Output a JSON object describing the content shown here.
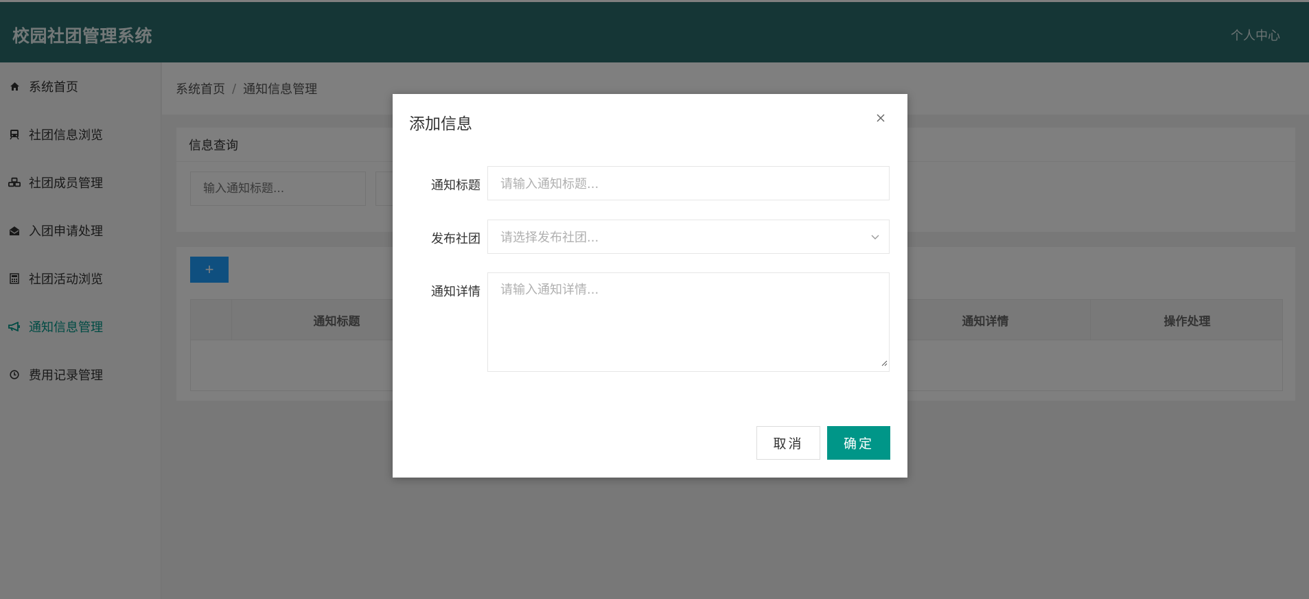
{
  "header": {
    "app_title": "校园社团管理系统",
    "user_center": "个人中心"
  },
  "sidebar": {
    "items": [
      {
        "label": "系统首页",
        "icon": "home-icon",
        "active": false
      },
      {
        "label": "社团信息浏览",
        "icon": "train-icon",
        "active": false
      },
      {
        "label": "社团成员管理",
        "icon": "cubes-icon",
        "active": false
      },
      {
        "label": "入团申请处理",
        "icon": "envelope-open-icon",
        "active": false
      },
      {
        "label": "社团活动浏览",
        "icon": "calculator-icon",
        "active": false
      },
      {
        "label": "通知信息管理",
        "icon": "bullhorn-icon",
        "active": true
      },
      {
        "label": "费用记录管理",
        "icon": "clock-icon",
        "active": false
      }
    ]
  },
  "breadcrumb": {
    "home": "系统首页",
    "separator": "/",
    "current": "通知信息管理"
  },
  "query_card": {
    "title": "信息查询",
    "title_placeholder": "输入通知标题..."
  },
  "table": {
    "add_label": "+",
    "columns": [
      "通知标题",
      "通知详情",
      "操作处理"
    ]
  },
  "modal": {
    "title": "添加信息",
    "fields": {
      "title_label": "通知标题",
      "title_placeholder": "请输入通知标题...",
      "club_label": "发布社团",
      "club_placeholder": "请选择发布社团...",
      "detail_label": "通知详情",
      "detail_placeholder": "请输入通知详情..."
    },
    "cancel_label": "取消",
    "ok_label": "确定"
  },
  "colors": {
    "header_bg": "#2b6d6d",
    "accent": "#009688",
    "add_button": "#1e9fff"
  }
}
